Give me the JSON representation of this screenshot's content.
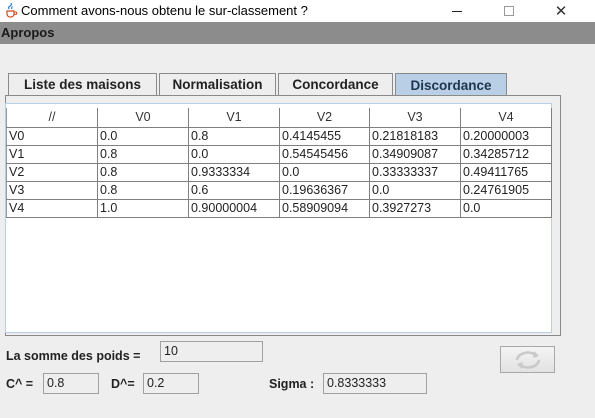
{
  "window": {
    "title": "Comment avons-nous obtenu le sur-classement ?",
    "minimize_icon": "minimize-icon",
    "maximize_icon": "maximize-icon",
    "close_glyph": "✕"
  },
  "menubar": {
    "apropos": "Apropos"
  },
  "tabs": [
    {
      "label": "Liste des maisons",
      "active": false
    },
    {
      "label": "Normalisation",
      "active": false
    },
    {
      "label": "Concordance",
      "active": false
    },
    {
      "label": "Discordance",
      "active": true
    }
  ],
  "table": {
    "headers": [
      "//",
      "V0",
      "V1",
      "V2",
      "V3",
      "V4"
    ],
    "rows": [
      [
        "V0",
        "0.0",
        "0.8",
        "0.4145455",
        "0.21818183",
        "0.20000003"
      ],
      [
        "V1",
        "0.8",
        "0.0",
        "0.54545456",
        "0.34909087",
        "0.34285712"
      ],
      [
        "V2",
        "0.8",
        "0.9333334",
        "0.0",
        "0.33333337",
        "0.49411765"
      ],
      [
        "V3",
        "0.8",
        "0.6",
        "0.19636367",
        "0.0",
        "0.24761905"
      ],
      [
        "V4",
        "1.0",
        "0.90000004",
        "0.58909094",
        "0.3927273",
        "0.0"
      ]
    ]
  },
  "form": {
    "somme_label": "La somme des poids =",
    "somme_value": "10",
    "c_label": "C^ =",
    "c_value": "0.8",
    "d_label": "D^=",
    "d_value": "0.2",
    "sigma_label": "Sigma :",
    "sigma_value": "0.8333333"
  },
  "colors": {
    "menubar": "#8c8c8c",
    "active_tab": "#b8cfe5",
    "refresh_arrows": "#c9c9c9"
  }
}
